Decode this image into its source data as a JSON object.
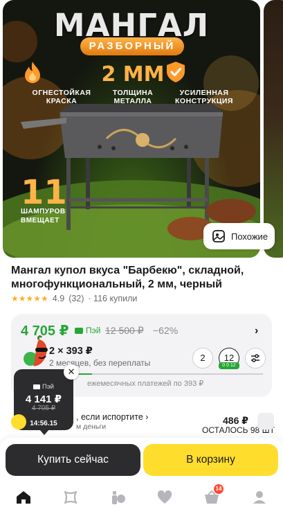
{
  "gallery": {
    "promo_title": "МАНГАЛ",
    "promo_subtitle": "РАЗБОРНЫЙ",
    "features": [
      {
        "icon": "flame-icon",
        "line1": "ОГНЕСТОЙКАЯ",
        "line2": "КРАСКА"
      },
      {
        "big": "2 ММ",
        "line1": "ТОЛЩИНА",
        "line2": "МЕТАЛЛА"
      },
      {
        "icon": "shield-check-icon",
        "line1": "УСИЛЕННАЯ",
        "line2": "КОНСТРУКЦИЯ"
      }
    ],
    "skewers_count": "11",
    "skewers_line1": "ШАМПУРОВ",
    "skewers_line2": "ВМЕЩАЕТ",
    "similar_label": "Похожие"
  },
  "product": {
    "title": "Мангал купол вкуса \"Барбекю\", складной, многофункциональный, 2 мм, черный",
    "rating": "4.9",
    "reviews": "(32)",
    "purchases": "· 116 купили"
  },
  "price": {
    "current": "4 705 ₽",
    "pay_label": "Пэй",
    "old": "12 500 ₽",
    "discount": "−62%",
    "installment_value": "2 × 393 ₽",
    "installment_sub": "2 месяцев, без переплаты",
    "term_2": "2",
    "term_12": "12",
    "term_12_badge": "0 0 12",
    "monthly_note": "ежемесячных платежей по 393 ₽",
    "progress_fraction": 0.08
  },
  "tooltip": {
    "pay_label": "Пэй",
    "price": "4 141 ₽",
    "old_price": "4 705 ₽",
    "timer": "14:56.15",
    "close": "✕"
  },
  "guarantee": {
    "text": ", если испортите ›",
    "sub": "м деньги",
    "side_price": "486 ₽",
    "stock": "ОСТАЛОСЬ 98 ШТ"
  },
  "actions": {
    "buy_now": "Купить сейчас",
    "to_cart": "В корзину"
  },
  "nav": {
    "cart_badge": "14"
  },
  "colors": {
    "accent_green": "#27a636",
    "accent_yellow": "#ffdd2d",
    "dark": "#2c2c2e",
    "badge_red": "#ff4b33"
  }
}
